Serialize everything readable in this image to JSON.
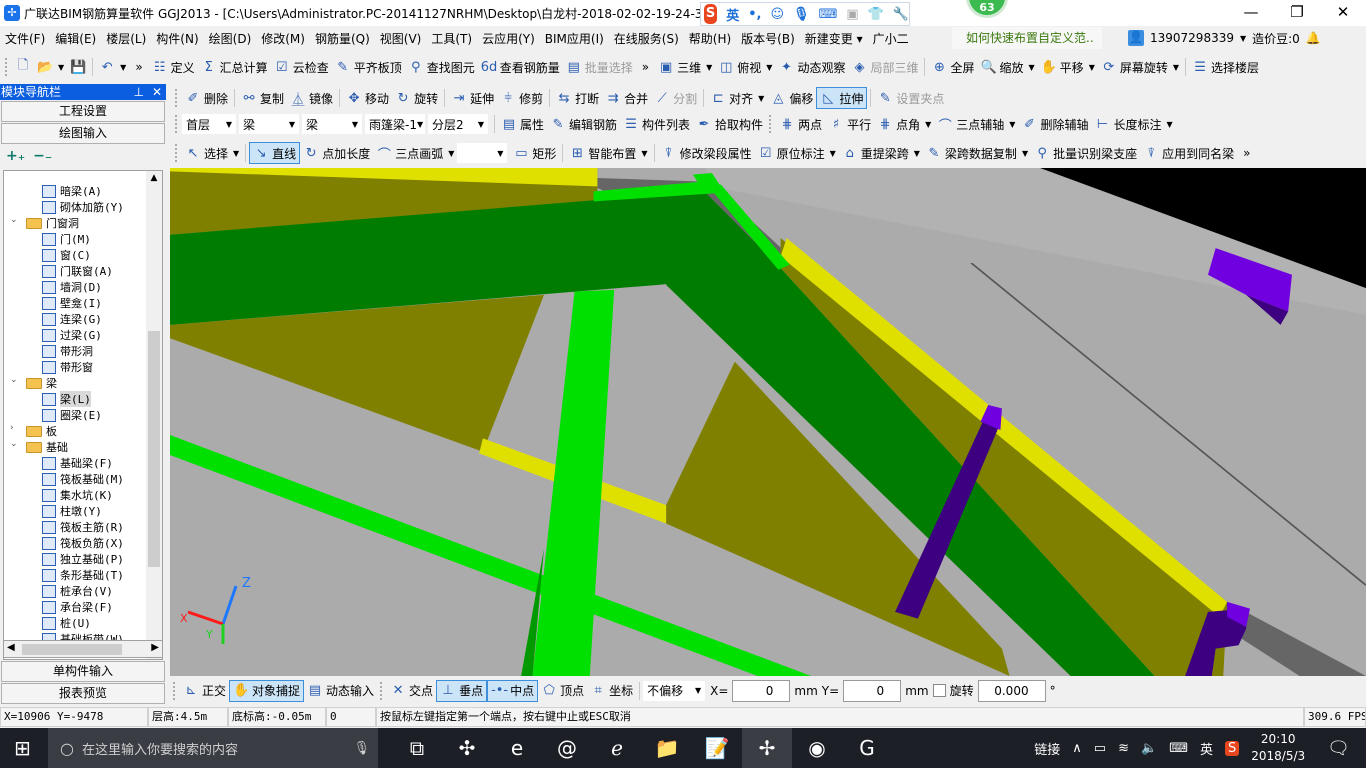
{
  "window": {
    "title": "广联达BIM钢筋算量软件 GGJ2013 - [C:\\Users\\Administrator.PC-20141127NRHM\\Desktop\\白龙村-2018-02-02-19-24-35",
    "minimize": "—",
    "restore": "❐",
    "close": "✕",
    "badge": "63"
  },
  "ime": {
    "logo": "S",
    "lang": "英",
    "punct": "•,",
    "icons": [
      "smile-icon",
      "mic-icon",
      "keyboard-icon",
      "user-card-icon",
      "shirt-icon",
      "wrench-icon"
    ]
  },
  "menu": [
    "文件(F)",
    "编辑(E)",
    "楼层(L)",
    "构件(N)",
    "绘图(D)",
    "修改(M)",
    "钢筋量(Q)",
    "视图(V)",
    "工具(T)",
    "云应用(Y)",
    "BIM应用(I)",
    "在线服务(S)",
    "帮助(H)",
    "版本号(B)",
    "新建变更 ▾",
    "广小二"
  ],
  "tip": "如何快速布置自定义范..",
  "user": {
    "phone": "13907298339",
    "beans": "造价豆:0"
  },
  "toolbar1": [
    {
      "icon": "new-icon",
      "g": "🗋"
    },
    {
      "icon": "open-icon",
      "g": "📂",
      "dd": true
    },
    {
      "icon": "save-icon",
      "g": "💾"
    },
    {
      "sep": true
    },
    {
      "icon": "undo-icon",
      "g": "↶",
      "dd": true
    },
    {
      "more": true
    },
    {
      "icon": "define-icon",
      "g": "☷",
      "label": "定义"
    },
    {
      "icon": "sigma-icon",
      "g": "Σ",
      "label": "汇总计算"
    },
    {
      "icon": "cloud-check-icon",
      "g": "☑",
      "label": "云检查"
    },
    {
      "icon": "align-slab-icon",
      "g": "✎",
      "label": "平齐板顶"
    },
    {
      "icon": "binoculars-icon",
      "g": "⚲",
      "label": "查找图元"
    },
    {
      "icon": "rebar-view-icon",
      "g": "6d",
      "label": "查看钢筋量"
    },
    {
      "icon": "batch-select-icon",
      "g": "▤",
      "label": "批量选择",
      "dis": true
    },
    {
      "more": true
    },
    {
      "icon": "cube-3d-icon",
      "g": "▣",
      "label": "三维",
      "dd": true
    },
    {
      "icon": "top-view-icon",
      "g": "◫",
      "label": "俯视",
      "dd": true
    },
    {
      "icon": "orbit-icon",
      "g": "✦",
      "label": "动态观察"
    },
    {
      "icon": "local-3d-icon",
      "g": "◈",
      "label": "局部三维",
      "dis": true
    },
    {
      "sep": true
    },
    {
      "icon": "fullscreen-icon",
      "g": "⊕",
      "label": "全屏"
    },
    {
      "icon": "zoom-icon",
      "g": "🔍",
      "label": "缩放",
      "dd": true
    },
    {
      "icon": "pan-icon",
      "g": "✋",
      "label": "平移",
      "dd": true
    },
    {
      "icon": "rotate-screen-icon",
      "g": "⟳",
      "label": "屏幕旋转",
      "dd": true
    },
    {
      "sep": true
    },
    {
      "icon": "select-floor-icon",
      "g": "☰",
      "label": "选择楼层"
    }
  ],
  "toolbar2": [
    {
      "icon": "delete-icon",
      "g": "✐",
      "label": "删除"
    },
    {
      "sep": true
    },
    {
      "icon": "copy-icon",
      "g": "⚯",
      "label": "复制"
    },
    {
      "icon": "mirror-icon",
      "g": "⏅",
      "label": "镜像"
    },
    {
      "sep": true
    },
    {
      "icon": "move-icon",
      "g": "✥",
      "label": "移动"
    },
    {
      "icon": "rotate-icon",
      "g": "↻",
      "label": "旋转"
    },
    {
      "sep": true
    },
    {
      "icon": "extend-icon",
      "g": "⇥",
      "label": "延伸"
    },
    {
      "icon": "trim-icon",
      "g": "⫩",
      "label": "修剪"
    },
    {
      "sep": true
    },
    {
      "icon": "break-icon",
      "g": "⇆",
      "label": "打断"
    },
    {
      "icon": "merge-icon",
      "g": "⇉",
      "label": "合并"
    },
    {
      "icon": "split-icon",
      "g": "⟋",
      "label": "分割",
      "dis": true
    },
    {
      "sep": true
    },
    {
      "icon": "align-icon",
      "g": "⊏",
      "label": "对齐",
      "dd": true
    },
    {
      "icon": "offset-icon",
      "g": "◬",
      "label": "偏移"
    },
    {
      "icon": "stretch-icon",
      "g": "◺",
      "label": "拉伸",
      "act": true
    },
    {
      "sep": true
    },
    {
      "icon": "grip-point-icon",
      "g": "✎",
      "label": "设置夹点",
      "dis": true
    }
  ],
  "toolbar3": {
    "combos": [
      "首层",
      "梁",
      "梁",
      "雨篷梁-1",
      "分层2"
    ],
    "items": [
      {
        "icon": "properties-icon",
        "g": "▤",
        "label": "属性"
      },
      {
        "icon": "edit-rebar-icon",
        "g": "✎",
        "label": "编辑钢筋"
      },
      {
        "icon": "component-list-icon",
        "g": "☰",
        "label": "构件列表"
      },
      {
        "icon": "pick-component-icon",
        "g": "✒",
        "label": "拾取构件"
      },
      {
        "grip": true
      },
      {
        "icon": "two-point-axis-icon",
        "g": "⋕",
        "label": "两点"
      },
      {
        "icon": "parallel-axis-icon",
        "g": "♯",
        "label": "平行"
      },
      {
        "icon": "point-angle-icon",
        "g": "⋕",
        "label": "点角",
        "dd": true
      },
      {
        "icon": "three-point-axis-icon",
        "g": "⌒",
        "label": "三点辅轴",
        "dd": true
      },
      {
        "icon": "delete-axis-icon",
        "g": "✐",
        "label": "删除辅轴"
      },
      {
        "icon": "length-dimension-icon",
        "g": "⊢",
        "label": "长度标注",
        "dd": true
      }
    ]
  },
  "toolbar4": [
    {
      "icon": "select-icon",
      "g": "↖",
      "label": "选择",
      "dd": true
    },
    {
      "sep": true
    },
    {
      "icon": "line-icon",
      "g": "↘",
      "label": "直线",
      "act": true
    },
    {
      "icon": "point-length-icon",
      "g": "↻",
      "label": "点加长度"
    },
    {
      "icon": "arc-icon",
      "g": "⌒",
      "label": "三点画弧",
      "dd": true
    },
    {
      "combo": true
    },
    {
      "icon": "rectangle-icon",
      "g": "▭",
      "label": "矩形"
    },
    {
      "sep": true
    },
    {
      "icon": "smart-layout-icon",
      "g": "⊞",
      "label": "智能布置",
      "dd": true
    },
    {
      "sep": true
    },
    {
      "icon": "modify-span-icon",
      "g": "⍒",
      "label": "修改梁段属性"
    },
    {
      "icon": "in-place-label-icon",
      "g": "☑",
      "label": "原位标注",
      "dd": true
    },
    {
      "icon": "re-extract-span-icon",
      "g": "⌂",
      "label": "重提梁跨",
      "dd": true
    },
    {
      "icon": "span-copy-icon",
      "g": "✎",
      "label": "梁跨数据复制",
      "dd": true
    },
    {
      "icon": "batch-support-icon",
      "g": "⚲",
      "label": "批量识别梁支座"
    },
    {
      "icon": "apply-same-name-icon",
      "g": "⍒",
      "label": "应用到同名梁"
    },
    {
      "more": true
    }
  ],
  "sidebar": {
    "title": "模块导航栏",
    "pin": "📌",
    "close": "✕",
    "buttons": {
      "project_settings": "工程设置",
      "drawing_input": "绘图输入",
      "single_input": "单构件输入",
      "report_preview": "报表预览"
    },
    "expand_all": "+₊",
    "collapse_all": "−₋",
    "tree": [
      {
        "label": "暗梁(A)",
        "lvl": 2
      },
      {
        "label": "砌体加筋(Y)",
        "lvl": 2
      },
      {
        "label": "门窗洞",
        "lvl": 1,
        "folder": true,
        "open": true
      },
      {
        "label": "门(M)",
        "lvl": 2
      },
      {
        "label": "窗(C)",
        "lvl": 2
      },
      {
        "label": "门联窗(A)",
        "lvl": 2
      },
      {
        "label": "墙洞(D)",
        "lvl": 2
      },
      {
        "label": "壁龛(I)",
        "lvl": 2
      },
      {
        "label": "连梁(G)",
        "lvl": 2
      },
      {
        "label": "过梁(G)",
        "lvl": 2
      },
      {
        "label": "带形洞",
        "lvl": 2
      },
      {
        "label": "带形窗",
        "lvl": 2
      },
      {
        "label": "梁",
        "lvl": 1,
        "folder": true,
        "open": true
      },
      {
        "label": "梁(L)",
        "lvl": 2,
        "selected": true
      },
      {
        "label": "圈梁(E)",
        "lvl": 2
      },
      {
        "label": "板",
        "lvl": 1,
        "folder": true,
        "open": false
      },
      {
        "label": "基础",
        "lvl": 1,
        "folder": true,
        "open": true
      },
      {
        "label": "基础梁(F)",
        "lvl": 2
      },
      {
        "label": "筏板基础(M)",
        "lvl": 2
      },
      {
        "label": "集水坑(K)",
        "lvl": 2
      },
      {
        "label": "柱墩(Y)",
        "lvl": 2
      },
      {
        "label": "筏板主筋(R)",
        "lvl": 2
      },
      {
        "label": "筏板负筋(X)",
        "lvl": 2
      },
      {
        "label": "独立基础(P)",
        "lvl": 2
      },
      {
        "label": "条形基础(T)",
        "lvl": 2
      },
      {
        "label": "桩承台(V)",
        "lvl": 2
      },
      {
        "label": "承台梁(F)",
        "lvl": 2
      },
      {
        "label": "桩(U)",
        "lvl": 2
      },
      {
        "label": "基础板带(W)",
        "lvl": 2
      }
    ]
  },
  "viewport": {
    "axes": {
      "x": "X",
      "y": "Y",
      "z": "Z"
    },
    "colors": {
      "ground": "#ababab",
      "beam_dark": "#007c00",
      "beam_light": "#00e000",
      "wall": "#808000",
      "edge": "#e0e000",
      "column": "#3d0080",
      "column_top": "#7000e0"
    }
  },
  "bottombar": {
    "items": [
      {
        "icon": "ortho-icon",
        "g": "⊾",
        "label": "正交"
      },
      {
        "icon": "object-snap-icon",
        "g": "✋",
        "label": "对象捕捉",
        "act": true
      },
      {
        "icon": "dynamic-input-icon",
        "g": "▤",
        "label": "动态输入"
      },
      {
        "grip": true
      },
      {
        "icon": "intersection-icon",
        "g": "✕",
        "label": "交点"
      },
      {
        "icon": "perpendicular-icon",
        "g": "⊥",
        "label": "垂点",
        "act": true
      },
      {
        "icon": "midpoint-icon",
        "g": "-•-",
        "label": "中点",
        "act": true
      },
      {
        "icon": "vertex-icon",
        "g": "⬠",
        "label": "顶点"
      },
      {
        "icon": "coordinate-icon",
        "g": "⌗",
        "label": "坐标"
      }
    ],
    "offset_mode": "不偏移",
    "x_label": "X=",
    "x_value": "0",
    "unit": "mm",
    "y_label": "Y=",
    "y_value": "0",
    "rotate_label": "旋转",
    "rotate_value": "0.000",
    "degree": "°"
  },
  "status": {
    "coords": "X=10906 Y=-9478",
    "floor_height": "层高:4.5m",
    "bottom_elev": "底标高:-0.05m",
    "value": "0",
    "message": "按鼠标左键指定第一个端点，按右键中止或ESC取消",
    "fps": "309.6 FPS"
  },
  "taskbar": {
    "search_placeholder": "在这里输入你要搜索的内容",
    "apps": [
      "task-view-icon",
      "fan-app-icon",
      "edge-icon",
      "spiral-app-icon",
      "ie-icon",
      "file-explorer-icon",
      "notes-app-icon",
      "glodon-app-icon",
      "green-browser-icon",
      "g-app-icon"
    ],
    "link": "链接",
    "lang": "英",
    "time": "20:10",
    "date": "2018/5/3"
  }
}
